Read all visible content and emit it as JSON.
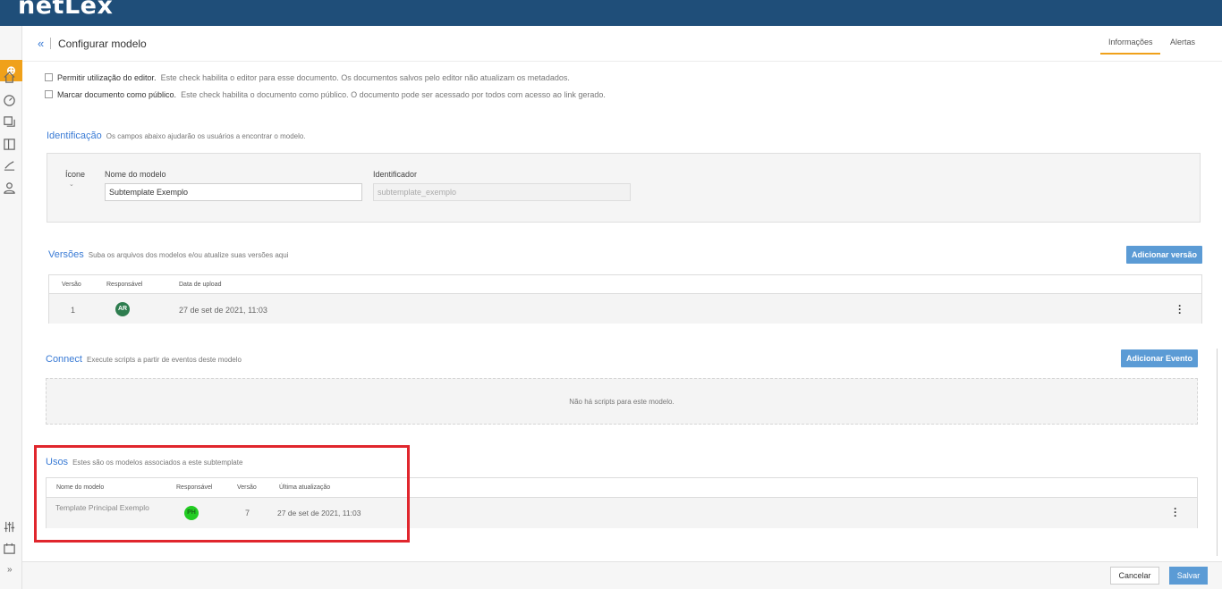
{
  "app": {
    "logo": "netLex"
  },
  "sidebar": {
    "home_glyph": "⊕",
    "expand_glyph": "»"
  },
  "header": {
    "back": "«",
    "title": "Configurar modelo",
    "tabs": [
      "Informações",
      "Alertas"
    ]
  },
  "options": [
    {
      "label": "Permitir utilização do editor.",
      "desc": "Este check habilita o editor para esse documento. Os documentos salvos pelo editor não atualizam os metadados."
    },
    {
      "label": "Marcar documento como público.",
      "desc": "Este check habilita o documento como público. O documento pode ser acessado por todos com acesso ao link gerado."
    }
  ],
  "identificacao": {
    "title": "Identificação",
    "sub": "Os campos abaixo ajudarão os usuários a encontrar o modelo.",
    "icone_label": "Ícone",
    "nome_label": "Nome do modelo",
    "nome_value": "Subtemplate Exemplo",
    "ident_label": "Identificador",
    "ident_value": "subtemplate_exemplo"
  },
  "versoes": {
    "title": "Versões",
    "sub": "Suba os arquivos dos modelos e/ou atualize suas versões aqui",
    "button": "Adicionar versão",
    "columns": [
      "Versão",
      "Responsável",
      "Data de upload"
    ],
    "rows": [
      {
        "versao": "1",
        "avatar": "AR",
        "data": "27 de set de 2021, 11:03"
      }
    ]
  },
  "connect": {
    "title": "Connect",
    "sub": "Execute scripts a partir de eventos deste modelo",
    "button": "Adicionar Evento",
    "empty": "Não há scripts para este modelo."
  },
  "usos": {
    "title": "Usos",
    "sub": "Estes são os modelos associados a este subtemplate",
    "columns": [
      "Nome do modelo",
      "Responsável",
      "Versão",
      "Última atualização"
    ],
    "rows": [
      {
        "nome": "Template Principal Exemplo",
        "avatar": "PH",
        "versao": "7",
        "data": "27 de set de 2021, 11:03"
      }
    ]
  },
  "footer": {
    "cancel": "Cancelar",
    "save": "Salvar"
  },
  "colors": {
    "brand": "#1f4e79",
    "accent": "#f0a11a",
    "link": "#3a7bd5",
    "button": "#5b9bd5",
    "highlight": "#e0262d",
    "avatar_ar": "#2e7d4f",
    "avatar_ph": "#22cc22"
  }
}
